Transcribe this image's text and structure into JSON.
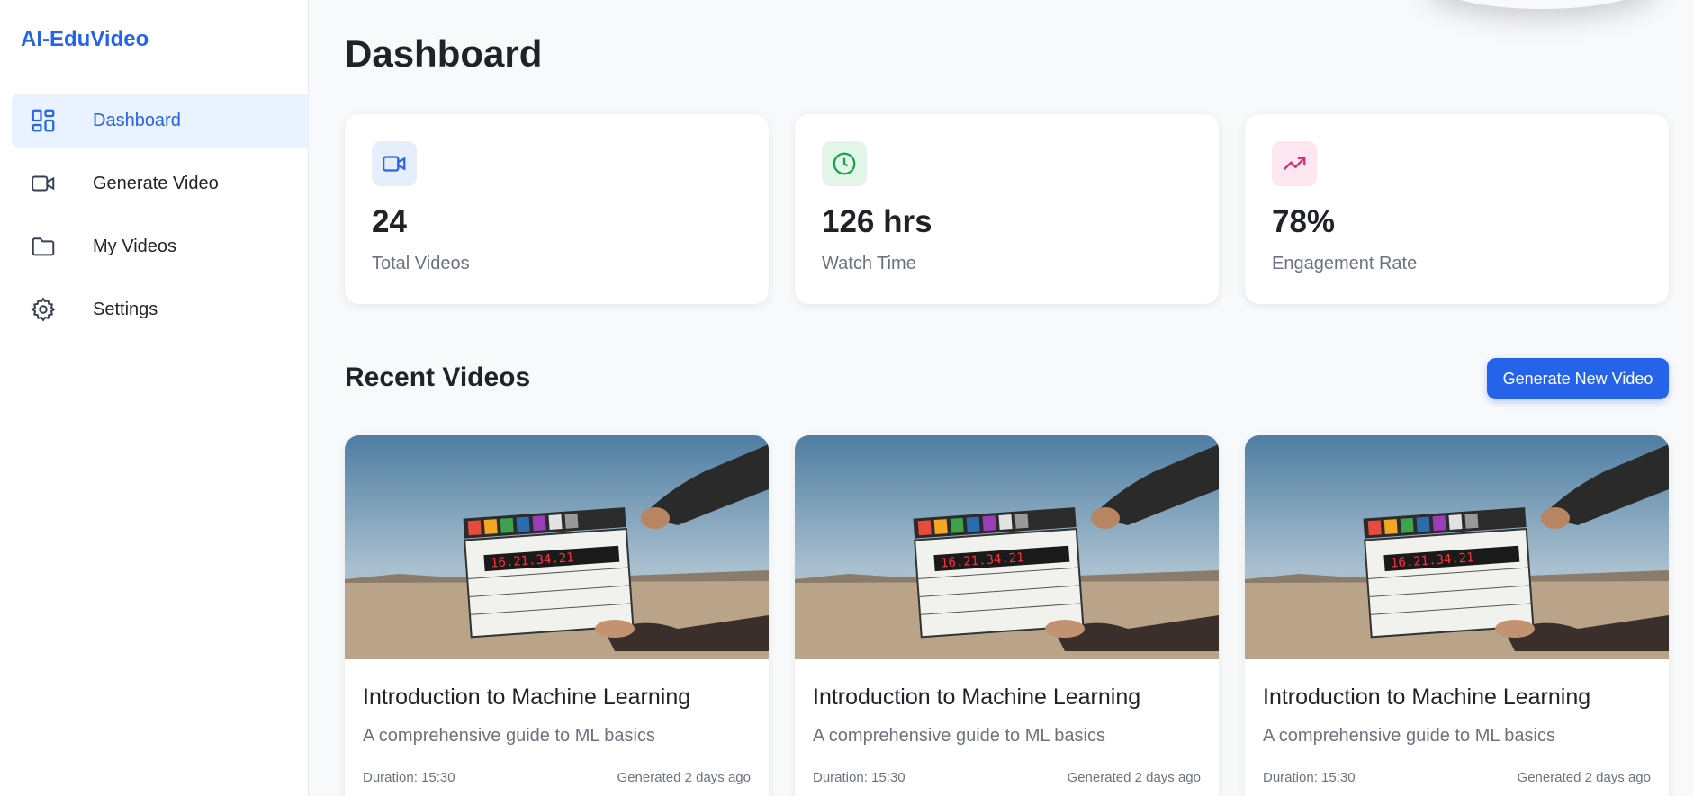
{
  "app": {
    "brand": "AI-EduVideo"
  },
  "sidebar": {
    "items": [
      {
        "label": "Dashboard",
        "icon": "dashboard-grid-icon",
        "active": true
      },
      {
        "label": "Generate Video",
        "icon": "video-camera-icon",
        "active": false
      },
      {
        "label": "My Videos",
        "icon": "folder-icon",
        "active": false
      },
      {
        "label": "Settings",
        "icon": "gear-icon",
        "active": false
      }
    ]
  },
  "main": {
    "title": "Dashboard",
    "stats": [
      {
        "value": "24",
        "label": "Total Videos",
        "icon": "video-camera-icon",
        "color": "#2563eb",
        "bg": "#e6eefc"
      },
      {
        "value": "126 hrs",
        "label": "Watch Time",
        "icon": "clock-icon",
        "color": "#16a34a",
        "bg": "#e3f5e9"
      },
      {
        "value": "78%",
        "label": "Engagement Rate",
        "icon": "trending-up-icon",
        "color": "#db2777",
        "bg": "#fce7f1"
      }
    ],
    "recent": {
      "title": "Recent Videos",
      "button_label": "Generate New Video",
      "videos": [
        {
          "title": "Introduction to Machine Learning",
          "description": "A comprehensive guide to ML basics",
          "duration": "Duration: 15:30",
          "generated": "Generated 2 days ago",
          "thumbnail": "clapperboard-image"
        },
        {
          "title": "Introduction to Machine Learning",
          "description": "A comprehensive guide to ML basics",
          "duration": "Duration: 15:30",
          "generated": "Generated 2 days ago",
          "thumbnail": "clapperboard-image"
        },
        {
          "title": "Introduction to Machine Learning",
          "description": "A comprehensive guide to ML basics",
          "duration": "Duration: 15:30",
          "generated": "Generated 2 days ago",
          "thumbnail": "clapperboard-image"
        }
      ]
    }
  },
  "colors": {
    "accent": "#2563eb",
    "active_bg": "#eaf2ff"
  }
}
